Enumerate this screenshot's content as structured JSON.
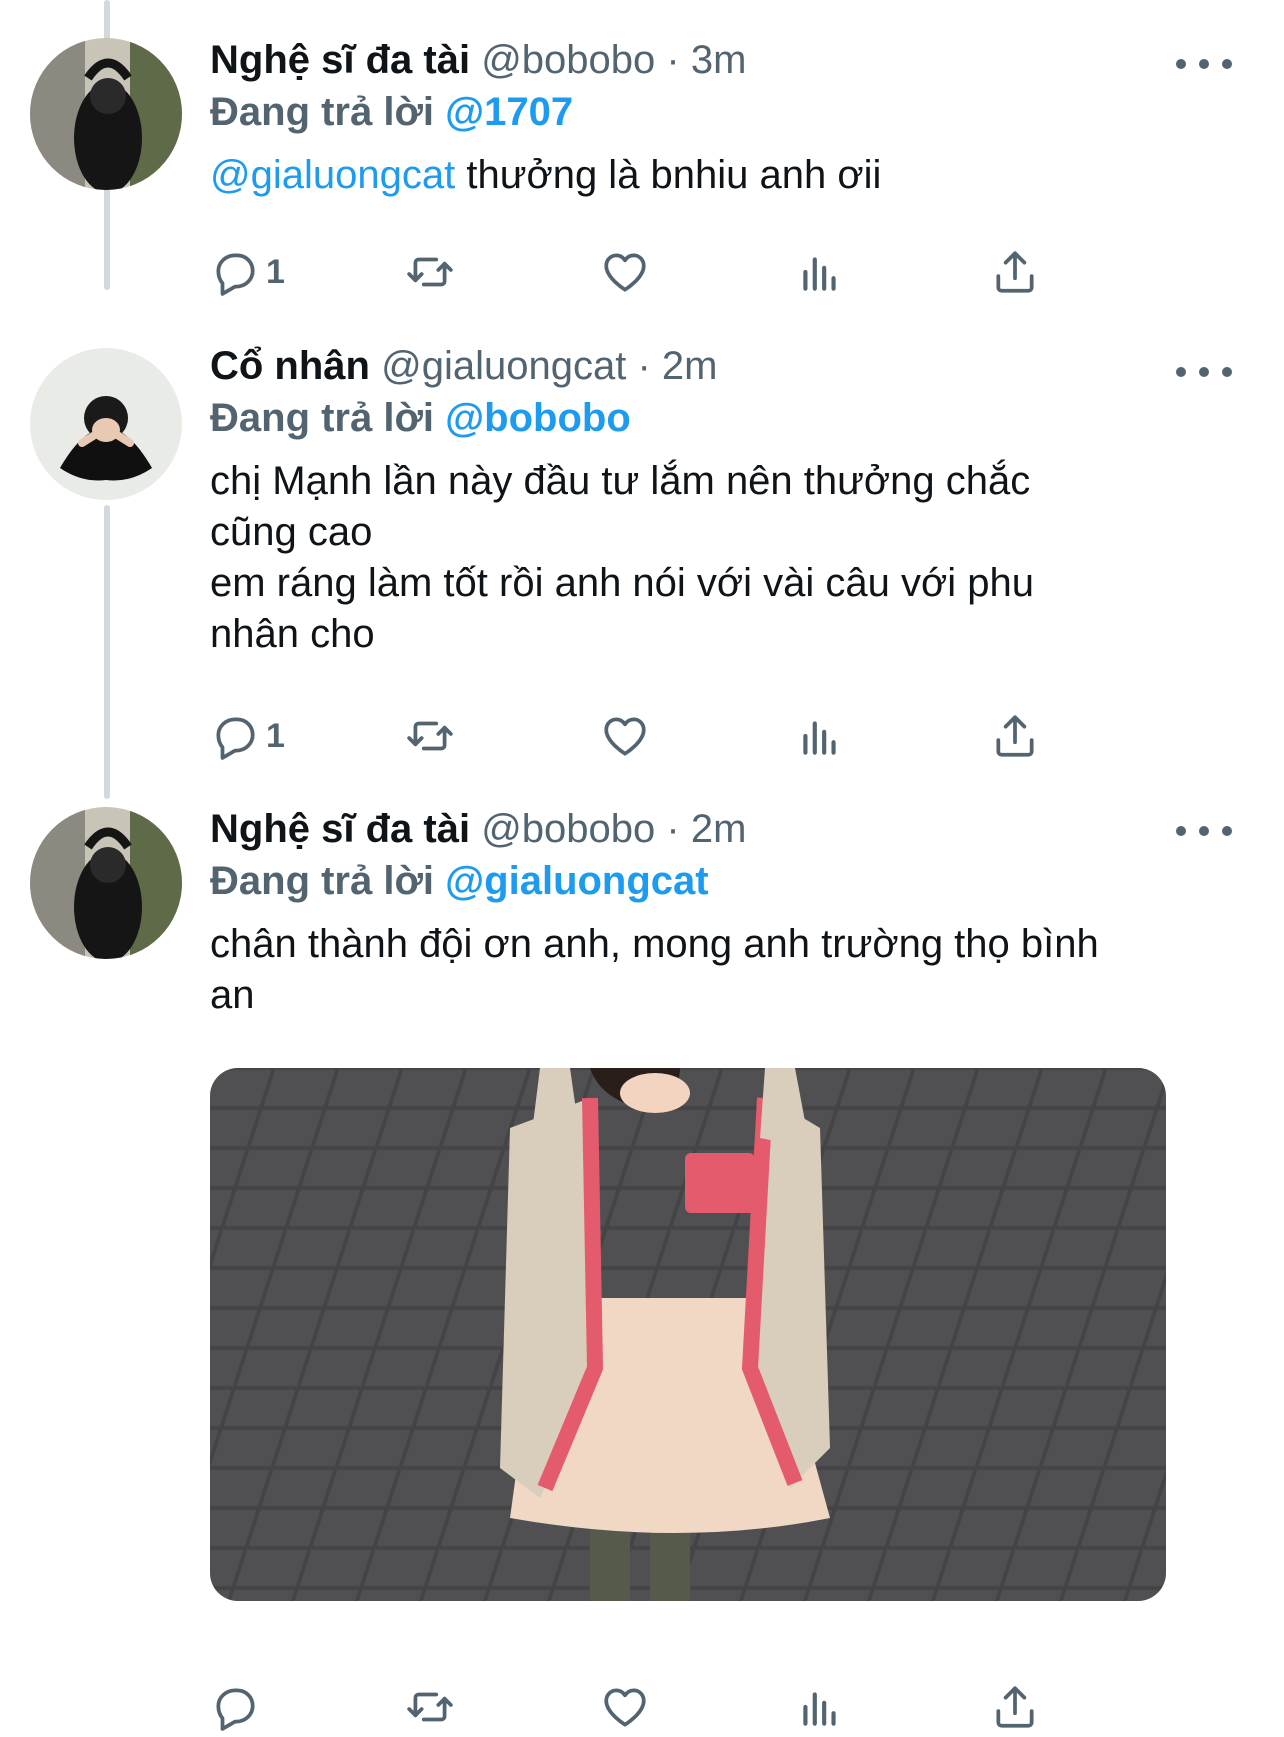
{
  "colors": {
    "accent": "#1d9bf0",
    "secondary_text": "#536471",
    "primary_text": "#0f1419",
    "thread_line": "#cfd9de"
  },
  "tweets": [
    {
      "name": "Nghệ sĩ đa tài",
      "handle": "@bobobo",
      "dot": "·",
      "time": "3m",
      "replying_prefix": "Đang trả lời",
      "replying_to": "@1707",
      "mention": "@gialuongcat",
      "text": " thưởng là bnhiu anh ơii",
      "reply_count": "1",
      "avatar_icon": "profile-photo"
    },
    {
      "name": "Cổ nhân",
      "handle": "@gialuongcat",
      "dot": "·",
      "time": "2m",
      "replying_prefix": "Đang trả lời",
      "replying_to": "@bobobo",
      "text": "chị Mạnh lần này đầu tư lắm nên thưởng chắc\ncũng cao\nem ráng làm tốt rồi anh nói với vài câu với phu\nnhân cho",
      "reply_count": "1",
      "avatar_icon": "profile-photo"
    },
    {
      "name": "Nghệ sĩ đa tài",
      "handle": "@bobobo",
      "dot": "·",
      "time": "2m",
      "replying_prefix": "Đang trả lời",
      "replying_to": "@gialuongcat",
      "text": "chân thành đội ơn anh, mong anh trường thọ bình\nan",
      "reply_count": "",
      "avatar_icon": "profile-photo",
      "media_icon": "photo-child-on-pavement"
    }
  ],
  "icons": {
    "reply": "reply-icon",
    "retweet": "retweet-icon",
    "like": "like-icon",
    "views": "views-icon",
    "share": "share-icon",
    "more": "more-icon"
  }
}
